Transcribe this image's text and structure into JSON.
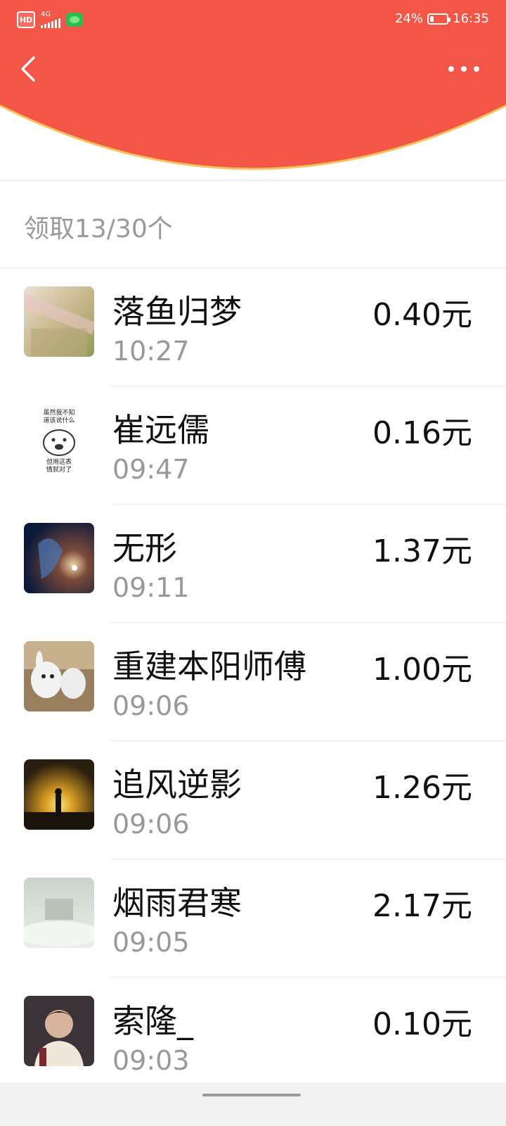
{
  "status_bar": {
    "hd": "HD",
    "network": "4G",
    "battery": "24%",
    "battery_level": 0.24,
    "time": "16:35"
  },
  "colors": {
    "header_red": "#f35646",
    "header_edge": "#f7c25c",
    "text_primary": "#111111",
    "text_secondary": "#999999"
  },
  "icons": {
    "back": "chevron-left-icon",
    "more": "more-dots-icon"
  },
  "summary": {
    "count_text": "领取13/30个"
  },
  "receivers": [
    {
      "name": "落鱼归梦",
      "time": "10:27",
      "amount": "0.40元"
    },
    {
      "name": "崔远儒",
      "time": "09:47",
      "amount": "0.16元",
      "avatar_caption_top": "虽然我不知道该说什么",
      "avatar_caption_bottom": "但用这表情就对了"
    },
    {
      "name": "无形",
      "time": "09:11",
      "amount": "1.37元"
    },
    {
      "name": "重建本阳师傅",
      "time": "09:06",
      "amount": "1.00元"
    },
    {
      "name": "追风逆影",
      "time": "09:06",
      "amount": "1.26元"
    },
    {
      "name": "烟雨君寒",
      "time": "09:05",
      "amount": "2.17元"
    },
    {
      "name": "索隆_",
      "time": "09:03",
      "amount": "0.10元"
    }
  ]
}
